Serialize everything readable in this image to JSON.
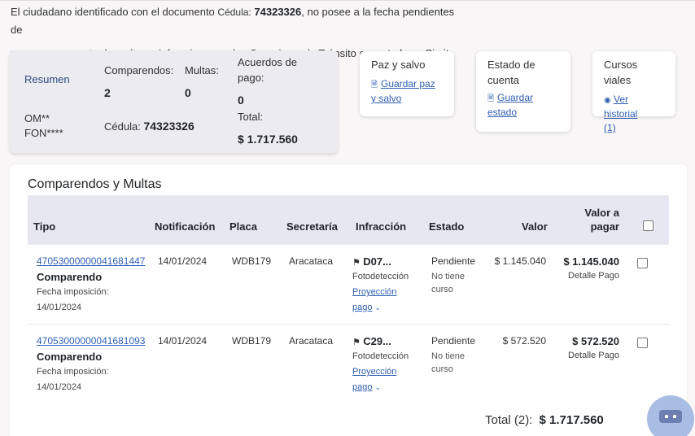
{
  "intro": {
    "part1": "El ciudadano identificado con el documento ",
    "doc_label": "Cédula:",
    "doc_number": "74323326",
    "part2": ", no posee a la fecha pendientes de",
    "line2": "pago por concepto de multas e infracciones en los Organismo de Tránsito conectados a Simit."
  },
  "summary": {
    "resumen_label": "Resumen",
    "om_line1": "OM**",
    "om_line2": "FON****",
    "comparendos_label": "Comparendos:",
    "comparendos_value": "2",
    "multas_label": "Multas:",
    "multas_value": "0",
    "acuerdos_label_1": "Acuerdos de",
    "acuerdos_label_2": "pago:",
    "acuerdos_value": "0",
    "cedula_label": "Cédula:",
    "cedula_value": "74323326",
    "total_label": "Total:",
    "total_value": "$ 1.717.560"
  },
  "cards": {
    "paz": {
      "title": "Paz y salvo",
      "link_1": "Guardar paz",
      "link_2": "y salvo",
      "icon": "document-icon"
    },
    "estado": {
      "title_1": "Estado de",
      "title_2": "cuenta",
      "link_1": "Guardar",
      "link_2": "estado",
      "icon": "document-icon"
    },
    "cursos": {
      "title": "Cursos viales",
      "link_1": "Ver historial",
      "link_2": "(1)",
      "icon": "eye-icon"
    }
  },
  "table": {
    "title": "Comparendos y Multas",
    "headers": {
      "tipo": "Tipo",
      "notificacion": "Notificación",
      "placa": "Placa",
      "secretaria": "Secretaría",
      "infraccion": "Infracción",
      "estado": "Estado",
      "valor": "Valor",
      "valor_pagar_1": "Valor a",
      "valor_pagar_2": "pagar"
    },
    "rows": [
      {
        "numero": "47053000000041681447",
        "tipo": "Comparendo",
        "fecha_label": "Fecha imposición:",
        "fecha": "14/01/2024",
        "notificacion": "14/01/2024",
        "placa": "WDB179",
        "secretaria": "Aracataca",
        "infraccion": "D07...",
        "medio": "Fotodetección",
        "proyeccion_1": "Proyección",
        "proyeccion_2": "pago",
        "estado": "Pendiente",
        "curso_1": "No tiene",
        "curso_2": "curso",
        "valor": "$ 1.145.040",
        "valor_pagar": "$ 1.145.040",
        "detalle": "Detalle Pago"
      },
      {
        "numero": "47053000000041681093",
        "tipo": "Comparendo",
        "fecha_label": "Fecha imposición:",
        "fecha": "14/01/2024",
        "notificacion": "14/01/2024",
        "placa": "WDB179",
        "secretaria": "Aracataca",
        "infraccion": "C29...",
        "medio": "Fotodetección",
        "proyeccion_1": "Proyección",
        "proyeccion_2": "pago",
        "estado": "Pendiente",
        "curso_1": "No tiene",
        "curso_2": "curso",
        "valor": "$ 572.520",
        "valor_pagar": "$ 572.520",
        "detalle": "Detalle Pago"
      }
    ],
    "total_label": "Total (2):",
    "total_value": "$ 1.717.560"
  },
  "colors": {
    "accent": "#2f5fb3",
    "header_bg": "#e6e7f0",
    "summary_bg": "#ebebf0"
  }
}
